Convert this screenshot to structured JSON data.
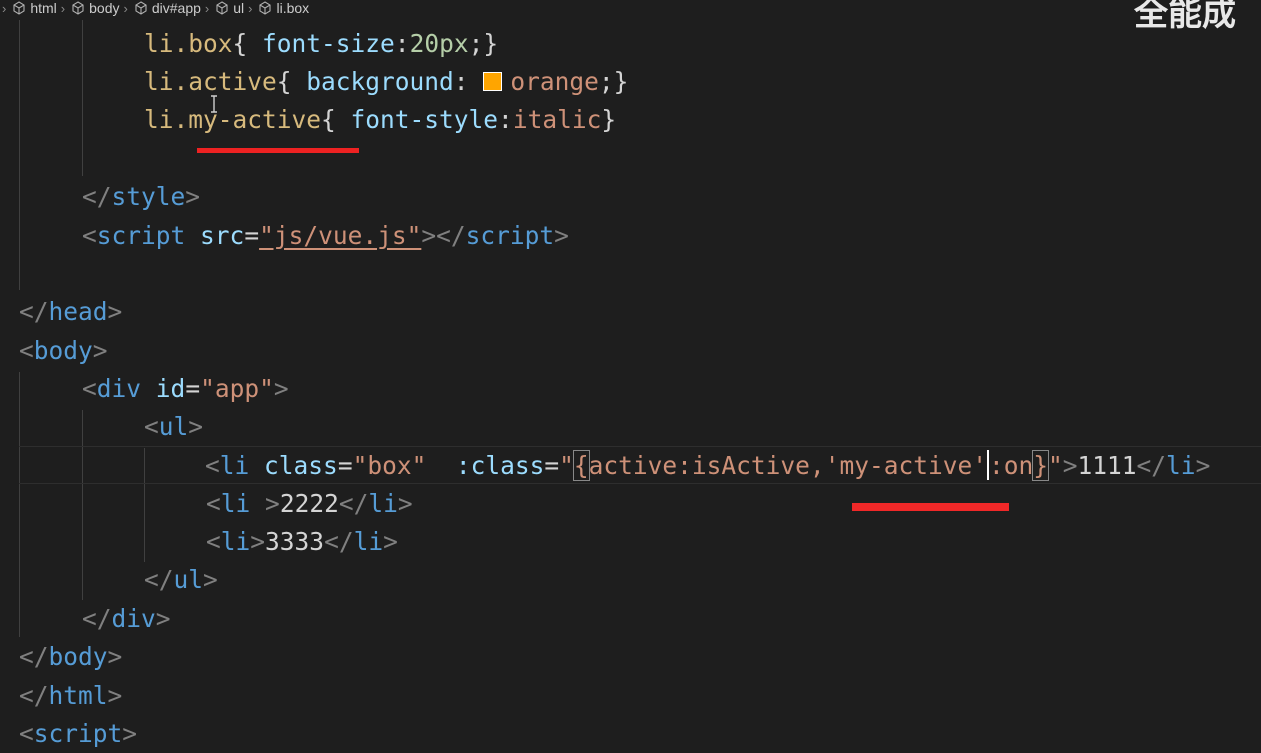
{
  "breadcrumb": [
    "html",
    "body",
    "div#app",
    "ul",
    "li.box"
  ],
  "watermark": "全能成",
  "code": {
    "line1": {
      "sel": "li.box",
      "open": "{ ",
      "prop": "font-size",
      "colon": ":",
      "value": "20px",
      "close": ";}"
    },
    "line2": {
      "sel": "li.active",
      "open": "{ ",
      "prop": "background",
      "colon": ": ",
      "value": "orange",
      "close": ";}"
    },
    "line3": {
      "sel": "li.my-active",
      "open": "{ ",
      "prop": "font-style",
      "colon": ":",
      "value": "italic",
      "close": "}"
    },
    "style_close": "style",
    "script_tag": "script",
    "script_attr": "src",
    "script_src": "\"js/vue.js\"",
    "head_close": "head",
    "body_open": "body",
    "div_tag": "div",
    "div_attr": "id",
    "div_id": "\"app\"",
    "ul_tag": "ul",
    "li1": {
      "tag": "li",
      "attr1": "class",
      "val1": "\"box\"",
      "attr2": ":class",
      "q_open": "\"",
      "b_open": "{",
      "expr1": "active:isActive,",
      "expr2": "'my-active'",
      "expr3": ":on",
      "b_close": "}",
      "q_close": "\"",
      "text": "1111"
    },
    "li2": {
      "tag": "li",
      "text": "2222"
    },
    "li3": {
      "tag": "li",
      "text": "3333"
    },
    "ul_close": "ul",
    "div_close": "div",
    "body_close": "body",
    "html_close": "html",
    "script_open": "script"
  },
  "colors": {
    "swatch": "#ffa500",
    "annotation": "#ee2222"
  }
}
